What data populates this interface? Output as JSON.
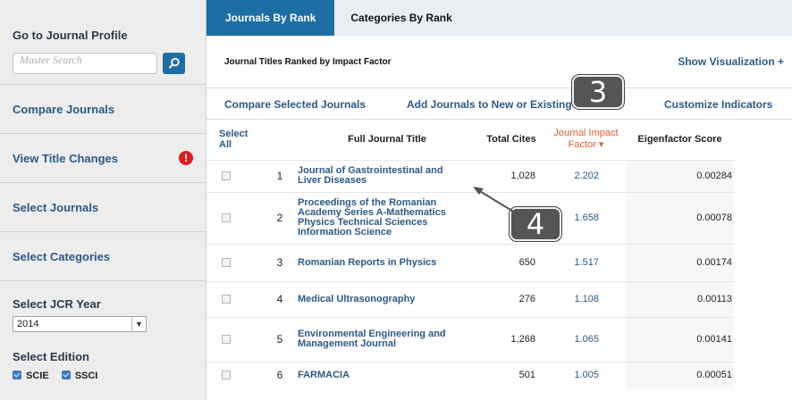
{
  "sidebar": {
    "goto_label": "Go to Journal Profile",
    "search_placeholder": "Master Search",
    "links": [
      "Compare Journals",
      "View Title Changes",
      "Select Journals",
      "Select Categories"
    ],
    "year_label": "Select JCR Year",
    "year_value": "2014",
    "edition_label": "Select Edition",
    "editions": [
      "SCIE",
      "SSCI"
    ]
  },
  "tabs": [
    "Journals By Rank",
    "Categories By Rank"
  ],
  "caption": "Journal Titles Ranked by Impact Factor",
  "show_visualization": "Show Visualization +",
  "actions": [
    "Compare Selected Journals",
    "Add Journals to New or Existing",
    "Customize Indicators"
  ],
  "table": {
    "headers": {
      "select_all": "Select All",
      "title": "Full Journal Title",
      "cites": "Total Cites",
      "jif": "Journal Impact Factor ▾",
      "eigen": "Eigenfactor Score"
    },
    "rows": [
      {
        "rank": "1",
        "title": "Journal of Gastrointestinal and Liver Diseases",
        "cites": "1,028",
        "jif": "2.202",
        "eigen": "0.00284"
      },
      {
        "rank": "2",
        "title": "Proceedings of the Romanian Academy Series A-Mathematics Physics Technical Sciences Information Science",
        "cites": "",
        "jif": "1.658",
        "eigen": "0.00078"
      },
      {
        "rank": "3",
        "title": "Romanian Reports in Physics",
        "cites": "650",
        "jif": "1.517",
        "eigen": "0.00174"
      },
      {
        "rank": "4",
        "title": "Medical Ultrasonography",
        "cites": "276",
        "jif": "1.108",
        "eigen": "0.00113"
      },
      {
        "rank": "5",
        "title": "Environmental Engineering and Management Journal",
        "cites": "1,268",
        "jif": "1.065",
        "eigen": "0.00141"
      },
      {
        "rank": "6",
        "title": "FARMACIA",
        "cites": "501",
        "jif": "1.005",
        "eigen": "0.00051"
      }
    ]
  },
  "callouts": [
    "3",
    "4"
  ],
  "colors": {
    "accent": "#1e6ea6",
    "link": "#2b5a86",
    "jif_header": "#e06131",
    "warning": "#d61f1f"
  }
}
